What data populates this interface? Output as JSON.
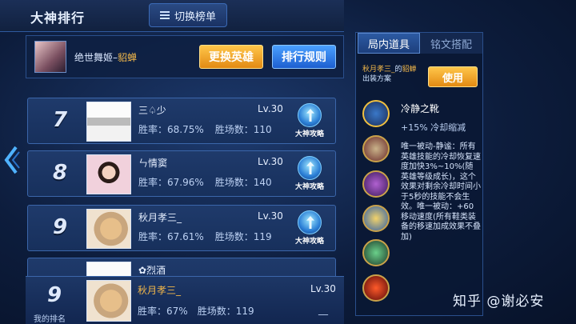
{
  "header": {
    "title": "大神排行",
    "switch_label": "切换榜单"
  },
  "hero": {
    "name_prefix": "绝世舞姬",
    "separator": "–",
    "hero_name": "貂蝉",
    "change_hero_label": "更换英雄",
    "rules_label": "排行规则"
  },
  "rows": [
    {
      "rank": "7",
      "name": "三♤少",
      "level": "Lv.30",
      "winrate": "胜率：68.75%",
      "matches": "胜场数：110",
      "guide": "大神攻略"
    },
    {
      "rank": "8",
      "name": "ㄣ情窦",
      "level": "Lv.30",
      "winrate": "胜率：67.96%",
      "matches": "胜场数：140",
      "guide": "大神攻略"
    },
    {
      "rank": "9",
      "name": "秋月孝三_",
      "level": "Lv.30",
      "winrate": "胜率：67.61%",
      "matches": "胜场数：119",
      "guide": "大神攻略"
    },
    {
      "name": "✿烈酒"
    }
  ],
  "my_rank": {
    "rank": "9",
    "label": "我的排名",
    "name": "秋月孝三_",
    "level": "Lv.30",
    "winrate": "胜率：67%",
    "matches": "胜场数：119",
    "dash": "__"
  },
  "side": {
    "tab_items": "局内道具",
    "tab_runes": "铭文搭配",
    "owner_name": "秋月孝三_",
    "owner_of": "的",
    "owner_hero": "貂蝉",
    "owner_line2": "出装方案",
    "use_label": "使用",
    "item_title": "冷静之靴",
    "item_sub": "+15% 冷却缩减",
    "item_desc": "唯一被动-静谧：所有英雄技能的冷却恢复速度加快3%~10%(随英雄等级成长)，这个效果对剩余冷却时间小于5秒的技能不会生效。唯一被动：+60移动速度(所有鞋类装备的移速加成效果不叠加)"
  },
  "watermark": "知乎 @谢必安",
  "icons": [
    "list-icon",
    "guide-icon",
    "chevron-left-icon",
    "boots-icon"
  ]
}
